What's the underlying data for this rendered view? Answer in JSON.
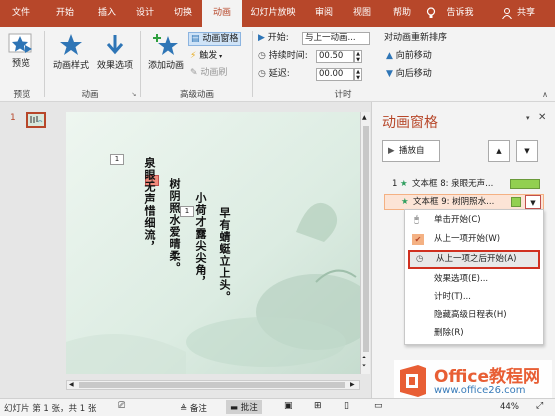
{
  "tabs": [
    "文件",
    "开始",
    "插入",
    "设计",
    "切换",
    "动画",
    "幻灯片放映",
    "审阅",
    "视图",
    "帮助"
  ],
  "tell_me": "告诉我",
  "share": "共享",
  "ribbon": {
    "preview_label": "预览",
    "preview_group": "预览",
    "anim_style": "动画样式",
    "effect_options": "效果选项",
    "anim_group": "动画",
    "add_anim": "添加动画",
    "anim_pane_btn": "动画窗格",
    "trigger": "触发",
    "anim_brush": "动画刷",
    "adv_group": "高级动画",
    "start_label": "开始:",
    "start_value": "与上一动画...",
    "duration_label": "持续时间:",
    "duration_value": "00.50",
    "delay_label": "延迟:",
    "delay_value": "00.00",
    "timing_group": "计时",
    "reorder_title": "对动画重新排序",
    "move_earlier": "向前移动",
    "move_later": "向后移动"
  },
  "thumb_number": "1",
  "slide": {
    "badge1": "1",
    "badge2": "1",
    "badge3": "1",
    "col1": "泉眼无声惜细流，",
    "col2": "树阴照水爱晴柔。",
    "col3": "小荷才露尖尖角，",
    "col4": "早有蜻蜓立上头。"
  },
  "pane": {
    "title": "动画窗格",
    "play_btn": "播放自",
    "item1_num": "1",
    "item1_text": "文本框 8: 泉眼无声...",
    "item2_text": "文本框 9: 树阴照水..."
  },
  "menu": {
    "opt1": "单击开始(C)",
    "opt2": "从上一项开始(W)",
    "opt3": "从上一项之后开始(A)",
    "opt4": "效果选项(E)...",
    "opt5": "计时(T)...",
    "opt6": "隐藏高级日程表(H)",
    "opt7": "删除(R)"
  },
  "status": {
    "slide_info": "幻灯片 第 1 张，共 1 张",
    "notes": "备注",
    "comments": "批注",
    "zoom": "44%"
  },
  "watermark": {
    "brand": "Office教程网",
    "url": "www.office26.com"
  },
  "colors": {
    "accent": "#b7472a",
    "highlight": "#d03020",
    "bar_green": "#92d050"
  }
}
